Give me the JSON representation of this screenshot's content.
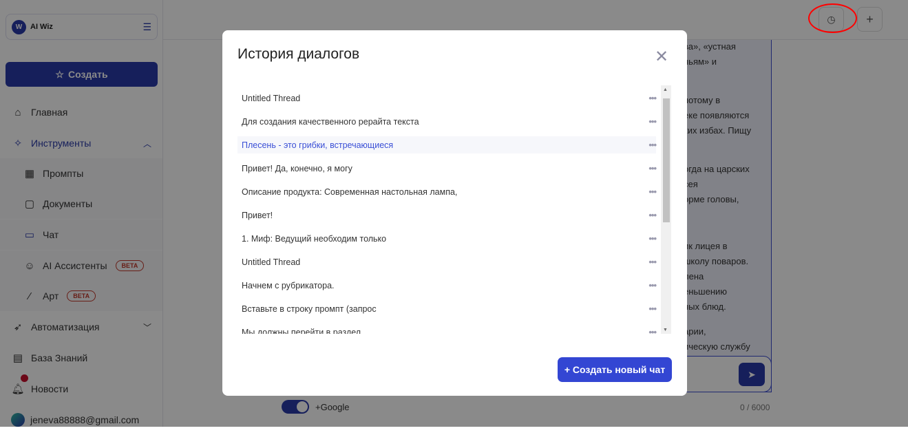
{
  "sidebar": {
    "brand": "AI Wiz",
    "create_label": "Создать",
    "items": [
      {
        "label": "Главная",
        "icon": "home-icon"
      },
      {
        "label": "Инструменты",
        "icon": "magic-wand-icon"
      },
      {
        "label": "Промпты",
        "icon": "grid-icon"
      },
      {
        "label": "Документы",
        "icon": "document-icon"
      },
      {
        "label": "Чат",
        "icon": "chat-icon"
      },
      {
        "label": "AI Ассистенты",
        "icon": "robot-icon",
        "badge": "BETA"
      },
      {
        "label": "Арт",
        "icon": "wand-icon",
        "badge": "BETA"
      },
      {
        "label": "Автоматизация",
        "icon": "rocket-icon"
      },
      {
        "label": "База Знаний",
        "icon": "book-icon"
      },
      {
        "label": "Новости",
        "icon": "bell-icon"
      }
    ],
    "user_email": "jeneva88888@gmail.com"
  },
  "header": {
    "history_icon": "clock-icon",
    "new_icon": "plus-icon"
  },
  "chat": {
    "fragments": [
      "ва», «устная",
      "ньям» и",
      "потому в",
      "еке появляются",
      "ких избах. Пищу",
      "огда на царских",
      "сея",
      "орме головы,",
      "ик лицея в",
      "школу поваров.",
      "лена",
      "еньшению",
      "ных блюд.",
      "арии,",
      "ическую службу"
    ],
    "toggle_label": "+Google",
    "toggle_on": true,
    "counter": "0 / 6000"
  },
  "modal": {
    "title": "История диалогов",
    "threads": [
      "Untitled Thread",
      "Для создания качественного рерайта текста",
      "Плесень - это грибки, встречающиеся",
      "Привет! Да, конечно, я могу",
      "Описание продукта: Современная настольная лампа,",
      "Привет!",
      "1. Миф: Ведущий необходим только",
      "Untitled Thread",
      "Начнем с рубрикатора.",
      "Вставьте в строку промпт (запрос",
      "Мы должны перейти в раздел"
    ],
    "active_index": 2,
    "new_chat_label": "+ Создать новый чат"
  },
  "colors": {
    "brand": "#2a3aa8",
    "button": "#3346d3",
    "active_link": "#3a4fd6",
    "beta": "#c0392b",
    "annotation": "#ff0000"
  }
}
